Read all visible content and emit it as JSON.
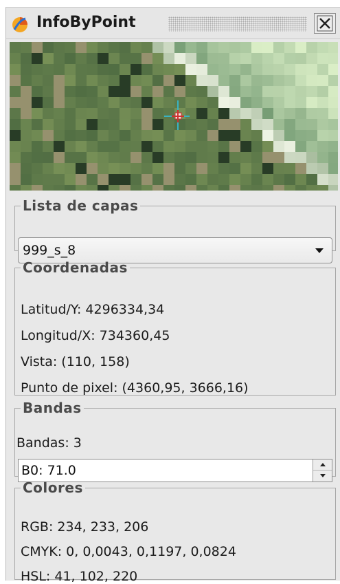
{
  "window": {
    "title": "InfoByPoint",
    "close_icon": "close-x-icon",
    "app_icon": "app-logo-icon"
  },
  "image_view": {
    "cursor_icon": "crosshair-icon"
  },
  "layers": {
    "legend": "Lista de capas",
    "selected": "999_s_8"
  },
  "coords": {
    "legend": "Coordenadas",
    "lat": "Latitud/Y: 4296334,34",
    "lon": "Longitud/X: 734360,45",
    "view": "Vista: (110, 158)",
    "pixel": "Punto de pixel: (4360,95, 3666,16)"
  },
  "bands": {
    "legend": "Bandas",
    "count": "Bandas: 3",
    "value": "B0: 71.0"
  },
  "colors": {
    "legend": "Colores",
    "rgb": "RGB: 234, 233, 206",
    "cmyk": "CMYK: 0, 0,0043, 0,1197, 0,0824",
    "hsl": "HSL: 41, 102, 220"
  }
}
